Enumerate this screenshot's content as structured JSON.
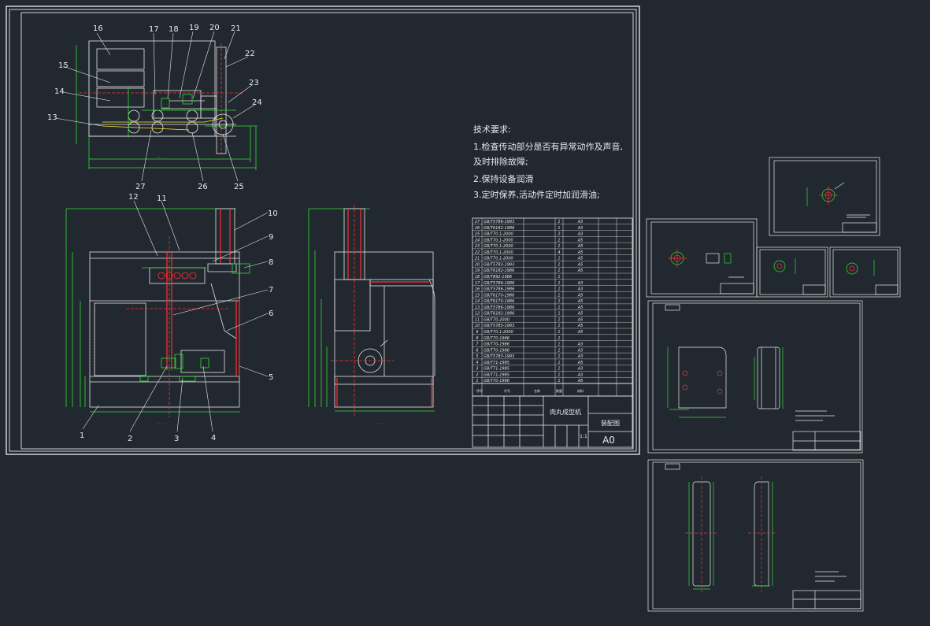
{
  "colors": {
    "background": "#212830",
    "frame": "#ffffff",
    "outline": "#e8e8e8",
    "green": "#33dd33",
    "red": "#ff3030",
    "magenta": "#ff33ff",
    "yellow": "#ffee33",
    "cyan": "#33dddd"
  },
  "main_sheet": {
    "callouts_top": [
      "16",
      "17",
      "18",
      "19",
      "20",
      "21",
      "22",
      "23",
      "24",
      "15",
      "14",
      "13",
      "27",
      "26",
      "25"
    ],
    "callouts_front": [
      "12",
      "11",
      "10",
      "9",
      "8",
      "7",
      "6",
      "5",
      "1",
      "2",
      "3",
      "4"
    ],
    "tech_requirements": {
      "heading": "技术要求:",
      "items": [
        "1.检查传动部分是否有异常动作及声音,",
        "及时排除故障;",
        "2.保持设备润滑",
        "3.定时保养,活动件定时加润滑油;"
      ]
    },
    "parts_table": {
      "rows": [
        {
          "no": "27",
          "std": "GB/T5786-1993",
          "qty": "1",
          "mat": "A3"
        },
        {
          "no": "26",
          "std": "GB/T6182-1986",
          "qty": "1",
          "mat": "A3"
        },
        {
          "no": "25",
          "std": "GB/T70.1-2000",
          "qty": "2",
          "mat": "A3"
        },
        {
          "no": "24",
          "std": "GB/T70.1-2000",
          "qty": "1",
          "mat": "A5"
        },
        {
          "no": "23",
          "std": "GB/T70.1-2000",
          "qty": "1",
          "mat": "A5"
        },
        {
          "no": "22",
          "std": "GB/T70.1-2000",
          "qty": "4",
          "mat": "A5"
        },
        {
          "no": "21",
          "std": "GB/T70.1-2000",
          "qty": "1",
          "mat": "A5"
        },
        {
          "no": "20",
          "std": "GB/T5783-1993",
          "qty": "1",
          "mat": "A5"
        },
        {
          "no": "19",
          "std": "GB/T6182-1986",
          "qty": "1",
          "mat": "A5"
        },
        {
          "no": "18",
          "std": "GB/T892-1986",
          "qty": "1",
          "mat": ""
        },
        {
          "no": "17",
          "std": "GB/T5786-1986",
          "qty": "1",
          "mat": "A3"
        },
        {
          "no": "16",
          "std": "GB/T5786-1986",
          "qty": "1",
          "mat": "A3"
        },
        {
          "no": "15",
          "std": "GB/T6170-1986",
          "qty": "1",
          "mat": "A5"
        },
        {
          "no": "14",
          "std": "GB/T6170-1986",
          "qty": "1",
          "mat": "A5"
        },
        {
          "no": "13",
          "std": "GB/T5786-1986",
          "qty": "1",
          "mat": "A5"
        },
        {
          "no": "12",
          "std": "GB/T6182-1986",
          "qty": "1",
          "mat": "A5"
        },
        {
          "no": "11",
          "std": "GB/T70-2000",
          "qty": "1",
          "mat": "A5"
        },
        {
          "no": "10",
          "std": "GB/T5783-1993",
          "qty": "1",
          "mat": "A5"
        },
        {
          "no": "9",
          "std": "GB/T70.1-2000",
          "qty": "1",
          "mat": "A5"
        },
        {
          "no": "8",
          "std": "GB/T70-1986",
          "qty": "1",
          "mat": ""
        },
        {
          "no": "7",
          "std": "GB/T70-1986",
          "qty": "1",
          "mat": "A3"
        },
        {
          "no": "6",
          "std": "GB/T70-1986",
          "qty": "1",
          "mat": "A3"
        },
        {
          "no": "5",
          "std": "GB/T5783-1993",
          "qty": "1",
          "mat": "A3"
        },
        {
          "no": "4",
          "std": "GB/T71-1985",
          "qty": "1",
          "mat": "A5"
        },
        {
          "no": "3",
          "std": "GB/T71-1985",
          "qty": "1",
          "mat": "A3"
        },
        {
          "no": "2",
          "std": "GB/T71-1985",
          "qty": "1",
          "mat": "A3"
        },
        {
          "no": "1",
          "std": "GB/T70-1986",
          "qty": "1",
          "mat": "A5"
        }
      ]
    },
    "title_block": {
      "name": "肉丸成型机",
      "drawing": "装配图",
      "scale": "1:1",
      "size": "A0"
    }
  }
}
